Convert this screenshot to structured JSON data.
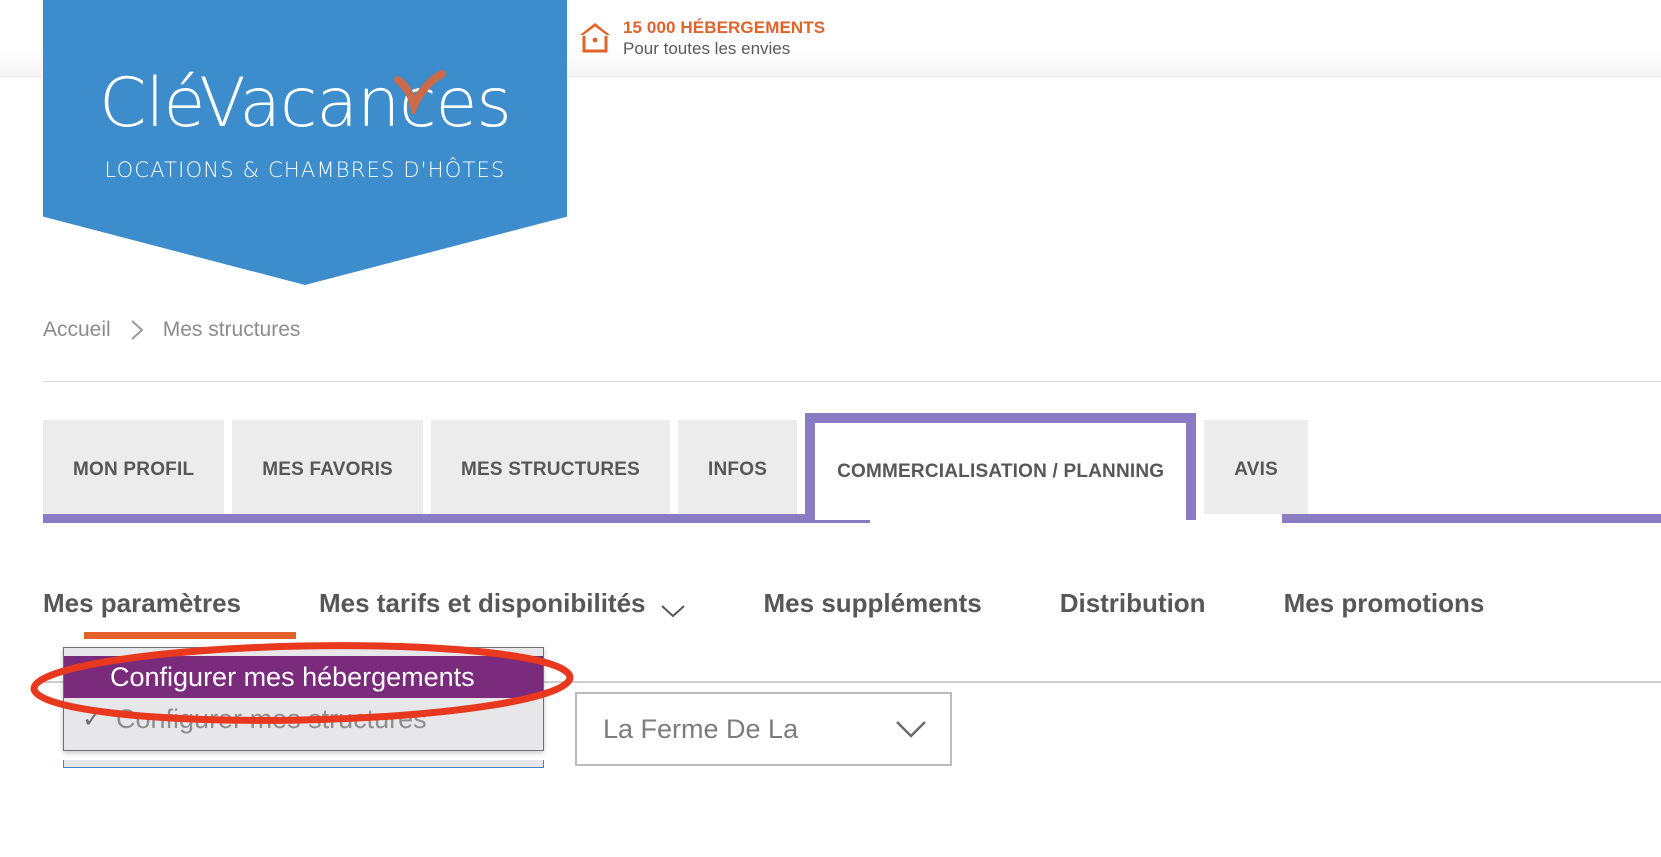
{
  "brand": {
    "logo_main": "CléVacances",
    "logo_sub": "LOCATIONS & CHAMBRES D'HÔTES",
    "logo_bg": "#3d8dcc",
    "check_color": "#c96a4a"
  },
  "tagline": {
    "icon": "house-icon",
    "line1": "15 000 HÉBERGEMENTS",
    "line2": "Pour toutes les envies",
    "accent": "#e2622a"
  },
  "breadcrumb": {
    "home": "Accueil",
    "separator": "chevron-right-icon",
    "current": "Mes structures"
  },
  "tabs": {
    "active_color": "#8a7cc4",
    "items": [
      {
        "label": "MON PROFIL",
        "active": false
      },
      {
        "label": "MES FAVORIS",
        "active": false
      },
      {
        "label": "MES STRUCTURES",
        "active": false
      },
      {
        "label": "INFOS",
        "active": false
      },
      {
        "label": "COMMERCIALISATION / PLANNING",
        "active": true
      },
      {
        "label": "AVIS",
        "active": false
      }
    ]
  },
  "subnav": {
    "active_underline_color": "#e2622a",
    "items": [
      {
        "label": "Mes paramètres",
        "active": true,
        "caret": false
      },
      {
        "label": "Mes tarifs et disponibilités",
        "active": false,
        "caret": true
      },
      {
        "label": "Mes suppléments",
        "active": false,
        "caret": false
      },
      {
        "label": "Distribution",
        "active": false,
        "caret": false
      },
      {
        "label": "Mes promotions",
        "active": false,
        "caret": false
      }
    ]
  },
  "dropdown": {
    "open": true,
    "highlight_color": "#7b2b7b",
    "items": [
      {
        "label": "Configurer mes hébergements",
        "highlighted": true,
        "checked": false
      },
      {
        "label": "Configurer mes structures",
        "highlighted": false,
        "checked": true,
        "check_glyph": "✓"
      }
    ]
  },
  "structure_select": {
    "value": "La Ferme De La",
    "caret": "chevron-down-icon"
  },
  "annotation": {
    "shape": "ellipse",
    "color": "#e8381d",
    "target": "Configurer mes hébergements"
  }
}
